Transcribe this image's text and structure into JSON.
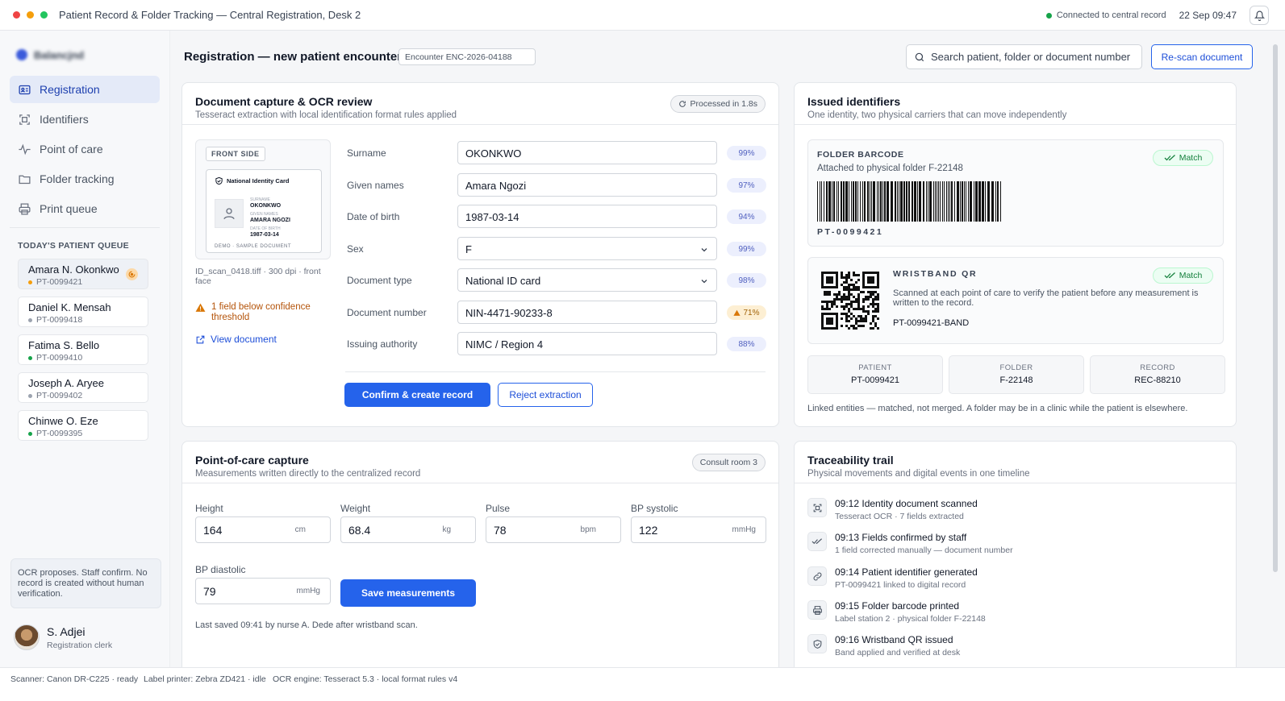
{
  "window": {
    "title": "Patient Record & Folder Tracking — Central Registration, Desk 2",
    "connection": "Connected to central record",
    "datetime": "22 Sep 09:47",
    "dot_colors": [
      "#ef4444",
      "#f59e0b",
      "#22c55e"
    ]
  },
  "sidebar": {
    "brand": "Balancjnd",
    "nav": [
      {
        "label": "Registration",
        "icon": "id-card-icon"
      },
      {
        "label": "Identifiers",
        "icon": "scan-frame-icon"
      },
      {
        "label": "Point of care",
        "icon": "pulse-icon"
      },
      {
        "label": "Folder tracking",
        "icon": "folder-icon"
      },
      {
        "label": "Print queue",
        "icon": "printer-icon"
      }
    ],
    "queue_title": "TODAY'S PATIENT QUEUE",
    "queue": [
      {
        "name": "Amara N. Okonkwo",
        "id": "PT-0099421",
        "status_color": "#f59e0b"
      },
      {
        "name": "Daniel K. Mensah",
        "id": "PT-0099418",
        "status_color": "#9ca3af"
      },
      {
        "name": "Fatima S. Bello",
        "id": "PT-0099410",
        "status_color": "#16a34a"
      },
      {
        "name": "Joseph A. Aryee",
        "id": "PT-0099402",
        "status_color": "#9ca3af"
      },
      {
        "name": "Chinwe O. Eze",
        "id": "PT-0099395",
        "status_color": "#16a34a"
      }
    ],
    "note": "OCR proposes. Staff confirm. No record is created without human verification.",
    "user": {
      "name": "S. Adjei",
      "role": "Registration clerk"
    }
  },
  "header": {
    "title": "Registration — new patient encounter",
    "encounter": "Encounter ENC-2026-04188",
    "search_placeholder": "Search patient, folder or document number",
    "rescan": "Re-scan document"
  },
  "capture": {
    "title": "Document capture & OCR review",
    "subtitle": "Tesseract extraction with local identification format rules applied",
    "processed": "Processed in 1.8s",
    "front_label": "FRONT SIDE",
    "card": {
      "title": "National Identity Card",
      "surname_label": "SURNAME",
      "surname": "OKONKWO",
      "given_label": "GIVEN NAMES",
      "given": "AMARA NGOZI",
      "dob_label": "DATE OF BIRTH",
      "dob": "1987-03-14",
      "footer": "DEMO · SAMPLE DOCUMENT"
    },
    "scan_caption": "ID_scan_0418.tiff · 300 dpi · front face",
    "warning": "1 field below confidence threshold",
    "view_document": "View document",
    "fields": [
      {
        "label": "Surname",
        "value": "OKONKWO",
        "confidence": "99%"
      },
      {
        "label": "Given names",
        "value": "Amara Ngozi",
        "confidence": "97%"
      },
      {
        "label": "Date of birth",
        "value": "1987-03-14",
        "confidence": "94%"
      },
      {
        "label": "Sex",
        "value": "F",
        "confidence": "99%"
      },
      {
        "label": "Document type",
        "value": "National ID card",
        "confidence": "98%"
      },
      {
        "label": "Document number",
        "value": "NIN-4471-90233-8",
        "confidence": "71%"
      },
      {
        "label": "Issuing authority",
        "value": "NIMC / Region 4",
        "confidence": "88%"
      }
    ],
    "confirm": "Confirm & create record",
    "reject": "Reject extraction"
  },
  "identifiers": {
    "title": "Issued identifiers",
    "subtitle": "One identity, two physical carriers that can move independently",
    "folder": {
      "title": "FOLDER BARCODE",
      "match": "Match",
      "attached": "Attached to physical folder F-22148",
      "code": "PT-0099421"
    },
    "wristband": {
      "title": "WRISTBAND QR",
      "match": "Match",
      "desc": "Scanned at each point of care to verify the patient before any measurement is written to the record.",
      "code": "PT-0099421-BAND"
    },
    "entities": [
      {
        "label": "PATIENT",
        "value": "PT-0099421"
      },
      {
        "label": "FOLDER",
        "value": "F-22148"
      },
      {
        "label": "RECORD",
        "value": "REC-88210"
      }
    ],
    "note": "Linked entities — matched, not merged. A folder may be in a clinic while the patient is elsewhere."
  },
  "poc": {
    "title": "Point-of-care capture",
    "subtitle": "Measurements written directly to the centralized record",
    "room": "Consult room 3",
    "vitals": [
      {
        "label": "Height",
        "value": "164",
        "unit": "cm"
      },
      {
        "label": "Weight",
        "value": "68.4",
        "unit": "kg"
      },
      {
        "label": "Pulse",
        "value": "78",
        "unit": "bpm"
      },
      {
        "label": "BP systolic",
        "value": "122",
        "unit": "mmHg"
      },
      {
        "label": "BP diastolic",
        "value": "79",
        "unit": "mmHg"
      }
    ],
    "save": "Save measurements",
    "last_saved": "Last saved 09:41 by nurse A. Dede after wristband scan."
  },
  "trail": {
    "title": "Traceability trail",
    "subtitle": "Physical movements and digital events in one timeline",
    "events": [
      {
        "title": "09:12 Identity document scanned",
        "sub": "Tesseract OCR · 7 fields extracted",
        "icon": "scan-frame-icon"
      },
      {
        "title": "09:13 Fields confirmed by staff",
        "sub": "1 field corrected manually — document number",
        "icon": "double-check-icon"
      },
      {
        "title": "09:14 Patient identifier generated",
        "sub": "PT-0099421 linked to digital record",
        "icon": "link-icon"
      },
      {
        "title": "09:15 Folder barcode printed",
        "sub": "Label station 2 · physical folder F-22148",
        "icon": "printer-icon"
      },
      {
        "title": "09:16 Wristband QR issued",
        "sub": "Band applied and verified at desk",
        "icon": "shield-check-icon"
      }
    ]
  },
  "status": {
    "scanner": "Scanner: Canon DR-C225 · ready",
    "printer": "Label printer: Zebra ZD421 · idle",
    "ocr": "OCR engine: Tesseract 5.3 · local format rules v4"
  }
}
